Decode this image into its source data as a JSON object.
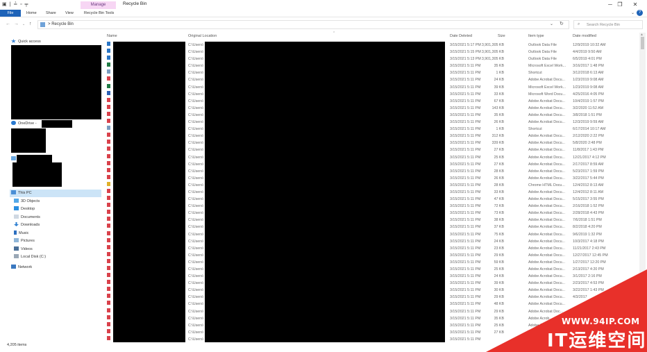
{
  "window": {
    "title": "Recycle Bin",
    "context_tab": "Manage",
    "quick_access_glyphs": "▣ | ≟ ▫ ╤",
    "minimize": "─",
    "maximize": "❐",
    "close": "✕"
  },
  "ribbon": {
    "tabs": [
      "File",
      "Home",
      "Share",
      "View",
      "Recycle Bin Tools"
    ],
    "collapse": "⌄",
    "help": "?"
  },
  "address": {
    "back": "←",
    "forward": "→",
    "recent": "⌄",
    "up": "↑",
    "path_separator": ">",
    "path": "Recycle Bin",
    "dropdown": "⌄",
    "refresh": "↻",
    "search_placeholder": "Search Recycle Bin",
    "search_icon": "⌕"
  },
  "nav": {
    "quick_access": "Quick access",
    "onedrive": "OneDrive -",
    "this_pc": "This PC",
    "pc_items": [
      "3D Objects",
      "Desktop",
      "Documents",
      "Downloads",
      "Music",
      "Pictures",
      "Videos",
      "Local Disk (C:)"
    ],
    "network": "Network"
  },
  "columns": {
    "name": "Name",
    "original_location": "Original Location",
    "date_deleted": "Date Deleted",
    "size": "Size",
    "item_type": "Item type",
    "date_modified": "Date modified"
  },
  "rows": [
    {
      "icon": "outlook",
      "loc": "C:\\Users\\",
      "deleted": "3/15/2021 5:17 PM",
      "size": "3,901,305 KB",
      "type": "Outlook Data File",
      "modified": "12/9/2019 10:32 AM"
    },
    {
      "icon": "outlook",
      "loc": "C:\\Users\\",
      "deleted": "3/15/2021 5:15 PM",
      "size": "3,901,305 KB",
      "type": "Outlook Data File",
      "modified": "4/4/2019 9:50 AM"
    },
    {
      "icon": "outlook",
      "loc": "C:\\Users\\",
      "deleted": "3/15/2021 5:13 PM",
      "size": "3,901,305 KB",
      "type": "Outlook Data File",
      "modified": "6/5/2019 4:01 PM"
    },
    {
      "icon": "excel",
      "loc": "C:\\Users\\",
      "deleted": "3/15/2021 5:11 PM",
      "size": "35 KB",
      "type": "Microsoft Excel Work...",
      "modified": "3/16/2017 1:48 PM"
    },
    {
      "icon": "shortcut",
      "loc": "C:\\Users\\",
      "deleted": "3/15/2021 5:11 PM",
      "size": "1 KB",
      "type": "Shortcut",
      "modified": "3/12/2018 6:13 AM"
    },
    {
      "icon": "pdf",
      "loc": "C:\\Users\\",
      "deleted": "3/15/2021 5:11 PM",
      "size": "24 KB",
      "type": "Adobe Acrobat Docu...",
      "modified": "1/23/2019 9:08 AM"
    },
    {
      "icon": "excel",
      "loc": "C:\\Users\\",
      "deleted": "3/15/2021 5:11 PM",
      "size": "39 KB",
      "type": "Microsoft Excel Work...",
      "modified": "1/23/2019 9:08 AM"
    },
    {
      "icon": "word",
      "loc": "C:\\Users\\",
      "deleted": "3/15/2021 5:11 PM",
      "size": "33 KB",
      "type": "Microsoft Word Docu...",
      "modified": "4/25/2016 4:05 PM"
    },
    {
      "icon": "pdf",
      "loc": "C:\\Users\\",
      "deleted": "3/15/2021 5:11 PM",
      "size": "67 KB",
      "type": "Adobe Acrobat Docu...",
      "modified": "10/4/2019 1:57 PM"
    },
    {
      "icon": "pdf",
      "loc": "C:\\Users\\",
      "deleted": "3/15/2021 5:11 PM",
      "size": "143 KB",
      "type": "Adobe Acrobat Docu...",
      "modified": "3/2/2020 11:52 AM"
    },
    {
      "icon": "pdf",
      "loc": "C:\\Users\\",
      "deleted": "3/15/2021 5:11 PM",
      "size": "35 KB",
      "type": "Adobe Acrobat Docu...",
      "modified": "3/8/2018 1:51 PM"
    },
    {
      "icon": "pdf",
      "loc": "C:\\Users\\",
      "deleted": "3/15/2021 5:11 PM",
      "size": "26 KB",
      "type": "Adobe Acrobat Docu...",
      "modified": "12/3/2019 9:59 AM"
    },
    {
      "icon": "shortcut",
      "loc": "C:\\Users\\",
      "deleted": "3/15/2021 5:11 PM",
      "size": "1 KB",
      "type": "Shortcut",
      "modified": "6/17/2014 10:17 AM"
    },
    {
      "icon": "pdf",
      "loc": "C:\\Users\\",
      "deleted": "3/15/2021 5:11 PM",
      "size": "312 KB",
      "type": "Adobe Acrobat Docu...",
      "modified": "2/12/2020 2:22 PM"
    },
    {
      "icon": "pdf",
      "loc": "C:\\Users\\",
      "deleted": "3/15/2021 5:11 PM",
      "size": "339 KB",
      "type": "Adobe Acrobat Docu...",
      "modified": "5/8/2020 2:48 PM"
    },
    {
      "icon": "pdf",
      "loc": "C:\\Users\\",
      "deleted": "3/15/2021 5:11 PM",
      "size": "27 KB",
      "type": "Adobe Acrobat Docu...",
      "modified": "11/8/2017 1:43 PM"
    },
    {
      "icon": "pdf",
      "loc": "C:\\Users\\",
      "deleted": "3/15/2021 5:11 PM",
      "size": "25 KB",
      "type": "Adobe Acrobat Docu...",
      "modified": "12/21/2017 4:12 PM"
    },
    {
      "icon": "pdf",
      "loc": "C:\\Users\\",
      "deleted": "3/15/2021 5:11 PM",
      "size": "27 KB",
      "type": "Adobe Acrobat Docu...",
      "modified": "2/17/2017 8:59 AM"
    },
    {
      "icon": "pdf",
      "loc": "C:\\Users\\",
      "deleted": "3/15/2021 5:11 PM",
      "size": "28 KB",
      "type": "Adobe Acrobat Docu...",
      "modified": "5/23/2017 1:59 PM"
    },
    {
      "icon": "pdf",
      "loc": "C:\\Users\\",
      "deleted": "3/15/2021 5:11 PM",
      "size": "26 KB",
      "type": "Adobe Acrobat Docu...",
      "modified": "3/22/2017 5:44 PM"
    },
    {
      "icon": "chrome",
      "loc": "C:\\Users\\",
      "deleted": "3/15/2021 5:11 PM",
      "size": "28 KB",
      "type": "Chrome HTML Docu...",
      "modified": "12/4/2012 8:13 AM"
    },
    {
      "icon": "pdf",
      "loc": "C:\\Users\\",
      "deleted": "3/15/2021 5:11 PM",
      "size": "33 KB",
      "type": "Adobe Acrobat Docu...",
      "modified": "12/4/2012 8:11 AM"
    },
    {
      "icon": "pdf",
      "loc": "C:\\Users\\",
      "deleted": "3/15/2021 5:11 PM",
      "size": "47 KB",
      "type": "Adobe Acrobat Docu...",
      "modified": "5/15/2017 3:55 PM"
    },
    {
      "icon": "pdf",
      "loc": "C:\\Users\\",
      "deleted": "3/15/2021 5:11 PM",
      "size": "72 KB",
      "type": "Adobe Acrobat Docu...",
      "modified": "2/16/2018 1:52 PM"
    },
    {
      "icon": "pdf",
      "loc": "C:\\Users\\",
      "deleted": "3/15/2021 5:11 PM",
      "size": "73 KB",
      "type": "Adobe Acrobat Docu...",
      "modified": "2/28/2018 4:43 PM"
    },
    {
      "icon": "pdf",
      "loc": "C:\\Users\\",
      "deleted": "3/15/2021 5:11 PM",
      "size": "38 KB",
      "type": "Adobe Acrobat Docu...",
      "modified": "7/6/2018 1:51 PM"
    },
    {
      "icon": "pdf",
      "loc": "C:\\Users\\",
      "deleted": "3/15/2021 5:11 PM",
      "size": "37 KB",
      "type": "Adobe Acrobat Docu...",
      "modified": "8/2/2018 4:20 PM"
    },
    {
      "icon": "pdf",
      "loc": "C:\\Users\\",
      "deleted": "3/15/2021 5:11 PM",
      "size": "75 KB",
      "type": "Adobe Acrobat Docu...",
      "modified": "9/6/2019 1:32 PM"
    },
    {
      "icon": "pdf",
      "loc": "C:\\Users\\",
      "deleted": "3/15/2021 5:11 PM",
      "size": "24 KB",
      "type": "Adobe Acrobat Docu...",
      "modified": "10/3/2017 4:18 PM"
    },
    {
      "icon": "pdf",
      "loc": "C:\\Users\\",
      "deleted": "3/15/2021 5:11 PM",
      "size": "23 KB",
      "type": "Adobe Acrobat Docu...",
      "modified": "11/21/2017 2:43 PM"
    },
    {
      "icon": "pdf",
      "loc": "C:\\Users\\",
      "deleted": "3/15/2021 5:11 PM",
      "size": "29 KB",
      "type": "Adobe Acrobat Docu...",
      "modified": "12/27/2017 12:45 PM"
    },
    {
      "icon": "pdf",
      "loc": "C:\\Users\\",
      "deleted": "3/15/2021 5:11 PM",
      "size": "59 KB",
      "type": "Adobe Acrobat Docu...",
      "modified": "1/27/2017 12:20 PM"
    },
    {
      "icon": "pdf",
      "loc": "C:\\Users\\",
      "deleted": "3/15/2021 5:11 PM",
      "size": "25 KB",
      "type": "Adobe Acrobat Docu...",
      "modified": "2/13/2017 4:20 PM"
    },
    {
      "icon": "pdf",
      "loc": "C:\\Users\\",
      "deleted": "3/15/2021 5:11 PM",
      "size": "24 KB",
      "type": "Adobe Acrobat Docu...",
      "modified": "3/1/2017 2:16 PM"
    },
    {
      "icon": "pdf",
      "loc": "C:\\Users\\",
      "deleted": "3/15/2021 5:11 PM",
      "size": "39 KB",
      "type": "Adobe Acrobat Docu...",
      "modified": "2/23/2017 4:53 PM"
    },
    {
      "icon": "pdf",
      "loc": "C:\\Users\\",
      "deleted": "3/15/2021 5:11 PM",
      "size": "30 KB",
      "type": "Adobe Acrobat Docu...",
      "modified": "3/22/2017 1:43 PM"
    },
    {
      "icon": "pdf",
      "loc": "C:\\Users\\",
      "deleted": "3/15/2021 5:11 PM",
      "size": "29 KB",
      "type": "Adobe Acrobat Docu...",
      "modified": "4/3/2017"
    },
    {
      "icon": "pdf",
      "loc": "C:\\Users\\",
      "deleted": "3/15/2021 5:11 PM",
      "size": "48 KB",
      "type": "Adobe Acrobat Docu...",
      "modified": ""
    },
    {
      "icon": "pdf",
      "loc": "C:\\Users\\",
      "deleted": "3/15/2021 5:11 PM",
      "size": "29 KB",
      "type": "Adobe Acrobat Doc...",
      "modified": ""
    },
    {
      "icon": "pdf",
      "loc": "C:\\Users\\",
      "deleted": "3/15/2021 5:11 PM",
      "size": "35 KB",
      "type": "Adobe Acrob...",
      "modified": ""
    },
    {
      "icon": "pdf",
      "loc": "C:\\Users\\",
      "deleted": "3/15/2021 5:11 PM",
      "size": "25 KB",
      "type": "Adobe A...",
      "modified": ""
    },
    {
      "icon": "pdf",
      "loc": "C:\\Users\\",
      "deleted": "3/15/2021 5:11 PM",
      "size": "27 KB",
      "type": "",
      "modified": ""
    },
    {
      "icon": "pdf",
      "loc": "C:\\Users\\",
      "deleted": "3/15/2021 5:11 PM",
      "size": "",
      "type": "",
      "modified": ""
    }
  ],
  "status": {
    "items": "4,205 items"
  },
  "watermark": {
    "url": "WWW.94IP.COM",
    "text": "IT运维空间"
  },
  "colors": {
    "file_tab": "#1e63b8",
    "manage_tab": "#f7d6f4",
    "selection": "#cce4f7",
    "watermark": "#e8302a",
    "pdf_icon": "#d9414b",
    "excel_icon": "#1f7a44",
    "word_icon": "#2b5fb5",
    "outlook_icon": "#2a76c6"
  }
}
